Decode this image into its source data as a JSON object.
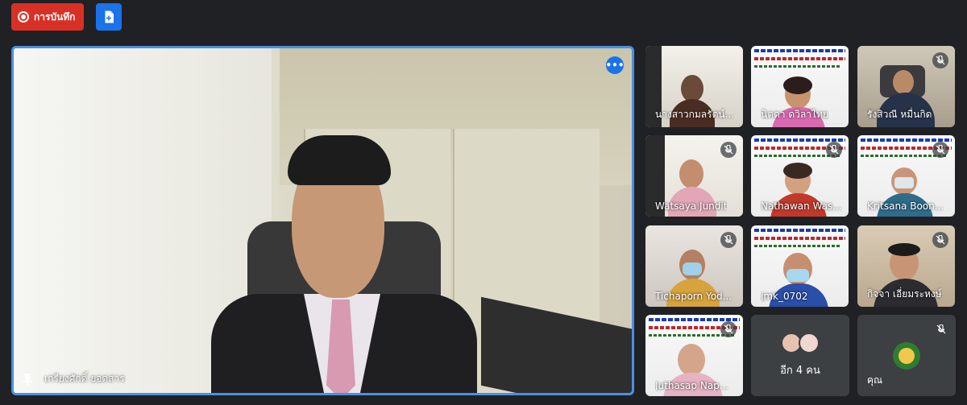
{
  "toolbar": {
    "record_label": "การบันทึก",
    "record_icon": "record-icon",
    "notes_icon": "add-note-icon"
  },
  "main_speaker": {
    "name": "เกรียงศักดิ์ ยอดสาร",
    "pin_icon": "pin-icon",
    "more_icon": "more-options-icon",
    "highlight_color": "#4a90e2"
  },
  "participants": [
    {
      "name": "นางสาวกมลรัตน์...",
      "muted": false
    },
    {
      "name": "นิตดา ดวิลาไทย",
      "muted": false
    },
    {
      "name": "รังสิวณี หมื่นกิด",
      "muted": true
    },
    {
      "name": "Watsaya Jundit",
      "muted": true
    },
    {
      "name": "Nathawan Was...",
      "muted": true
    },
    {
      "name": "Kritsana Boon...",
      "muted": true
    },
    {
      "name": "Tichaporn Yod...",
      "muted": true
    },
    {
      "name": "jmk_0702",
      "muted": true
    },
    {
      "name": "กิจจา เอี่ยมระหงษ์",
      "muted": true
    },
    {
      "name": "Juthasap Nap...",
      "muted": true
    }
  ],
  "more_people": {
    "label": "อีก 4 คน"
  },
  "self": {
    "name": "คุณ",
    "muted": true
  },
  "colors": {
    "background": "#202124",
    "record": "#d93025",
    "accent": "#1a73e8",
    "tile": "#3c4043"
  }
}
